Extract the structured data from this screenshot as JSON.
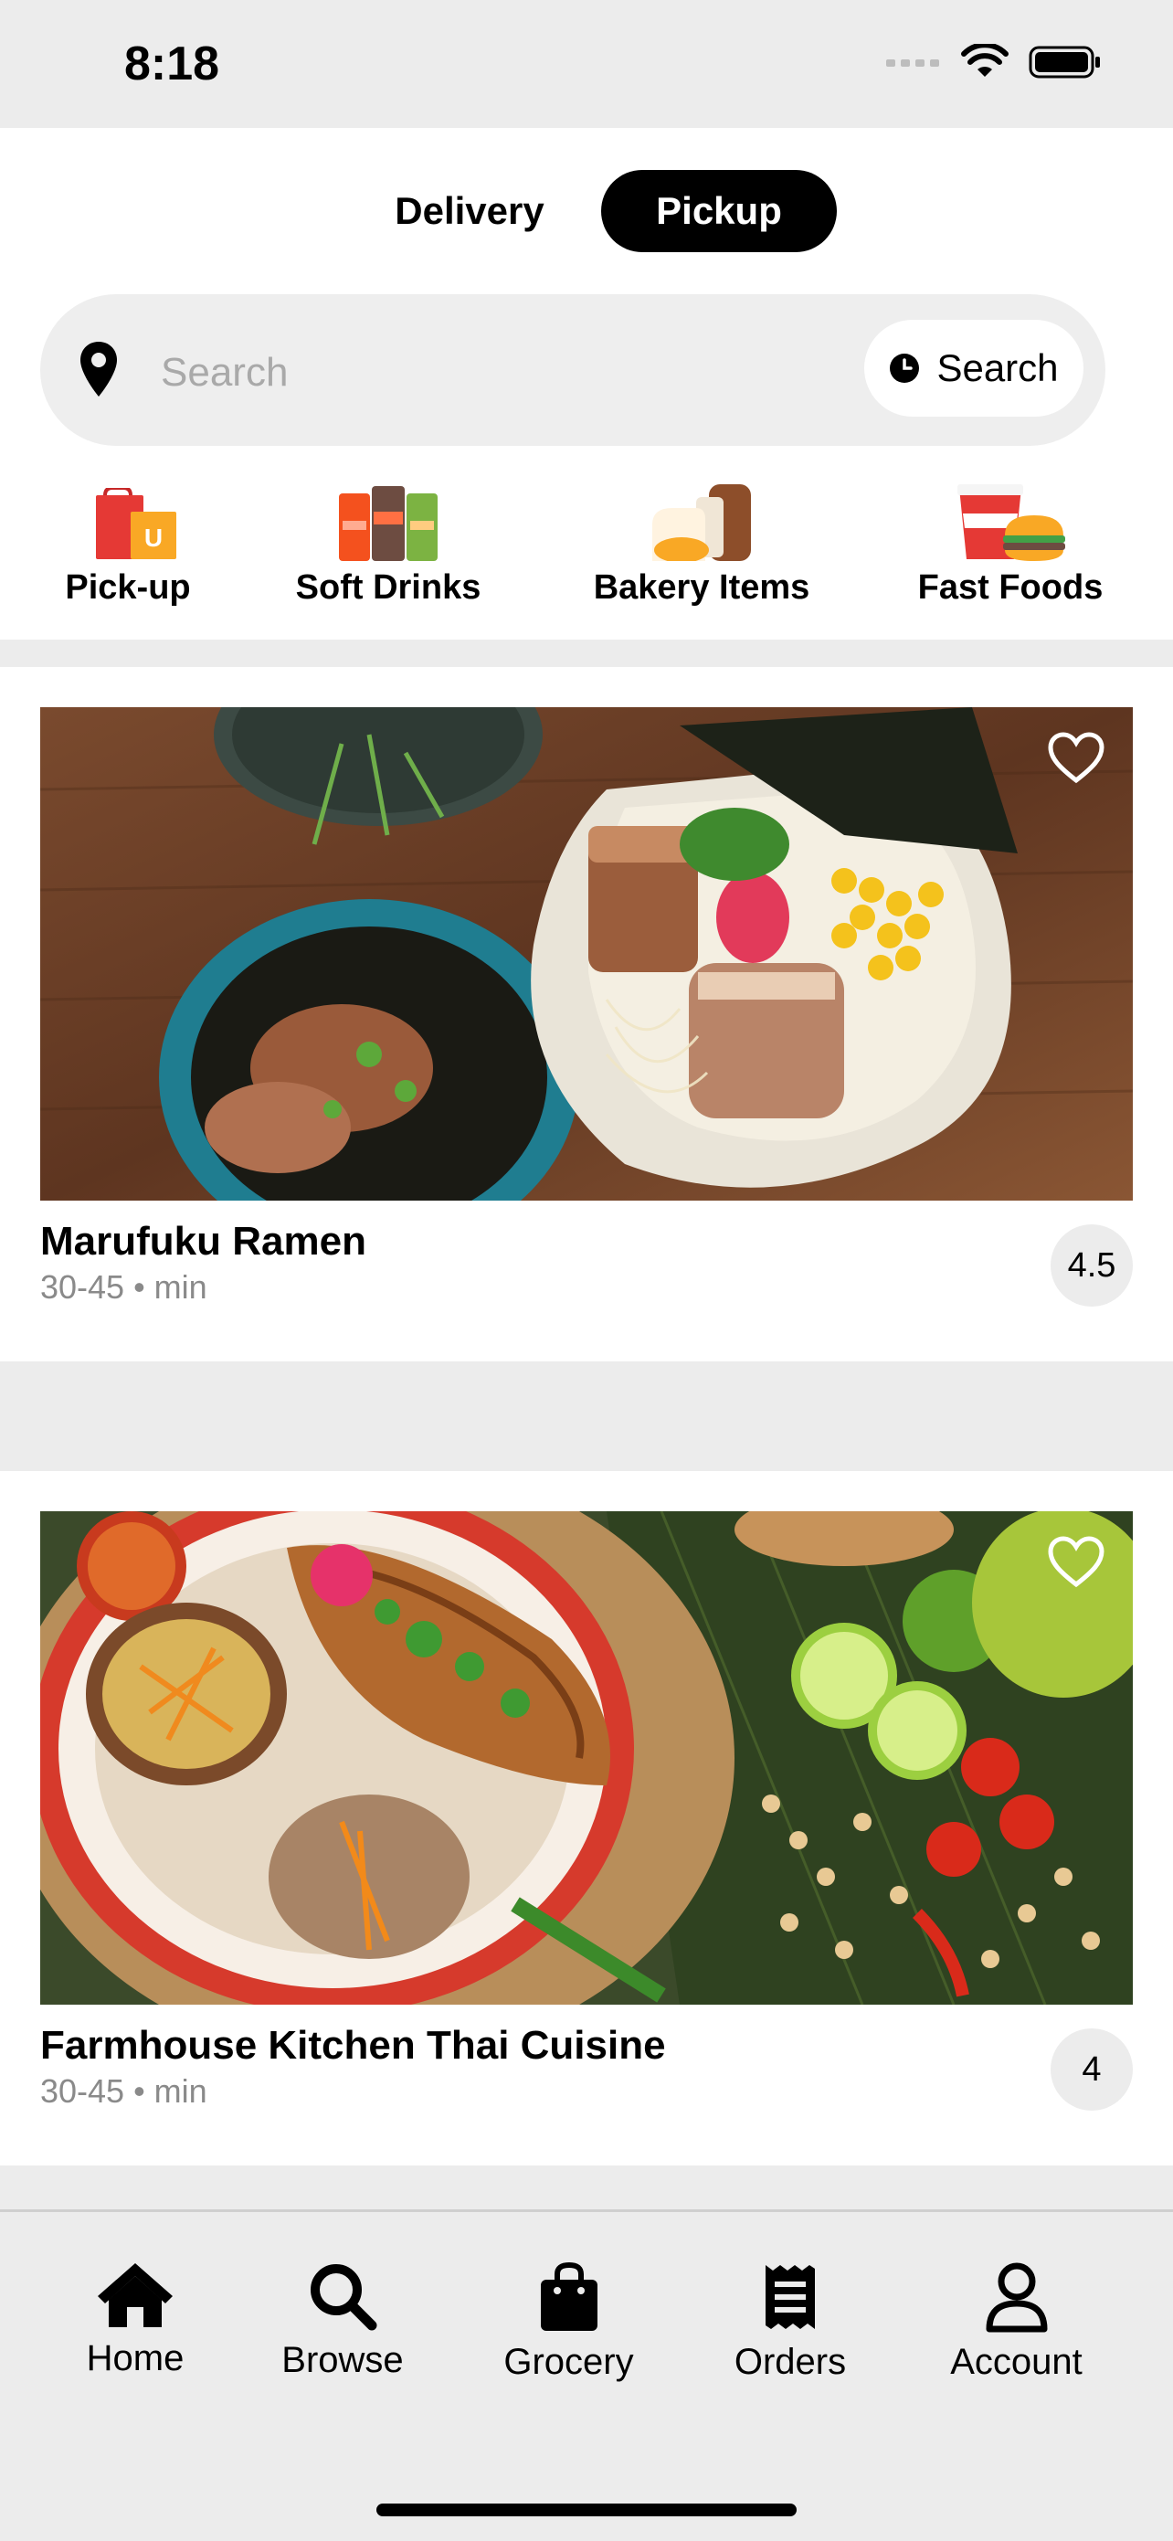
{
  "status_bar": {
    "time": "8:18"
  },
  "mode_toggle": {
    "delivery_label": "Delivery",
    "pickup_label": "Pickup",
    "selected": "Pickup"
  },
  "search": {
    "placeholder": "Search",
    "schedule_label": "Search"
  },
  "categories": [
    {
      "label": "Pick-up",
      "icon": "shopping-bags-icon"
    },
    {
      "label": "Soft Drinks",
      "icon": "soft-drinks-icon"
    },
    {
      "label": "Bakery Items",
      "icon": "bakery-icon"
    },
    {
      "label": "Fast Foods",
      "icon": "fast-food-icon"
    }
  ],
  "restaurants": [
    {
      "name": "Marufuku Ramen",
      "meta": "30-45 • min",
      "rating": "4.5"
    },
    {
      "name": "Farmhouse Kitchen Thai Cuisine",
      "meta": "30-45 • min",
      "rating": "4"
    }
  ],
  "tab_bar": [
    {
      "label": "Home",
      "icon": "home-icon"
    },
    {
      "label": "Browse",
      "icon": "search-icon"
    },
    {
      "label": "Grocery",
      "icon": "shopping-bag-icon"
    },
    {
      "label": "Orders",
      "icon": "receipt-icon"
    },
    {
      "label": "Account",
      "icon": "person-icon"
    }
  ],
  "colors": {
    "accent": "#000000",
    "background": "#ececec",
    "card": "#ffffff",
    "muted_text": "#8a8a8a"
  }
}
